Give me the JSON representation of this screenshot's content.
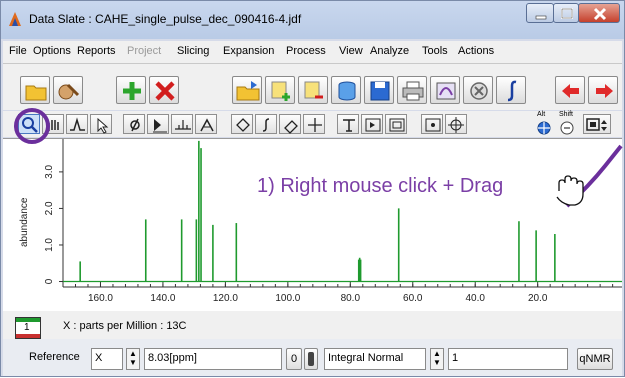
{
  "window": {
    "title": "Data Slate : CAHE_single_pulse_dec_090416-4.jdf"
  },
  "menu": [
    {
      "label": "File",
      "disabled": false
    },
    {
      "label": "Options",
      "disabled": false
    },
    {
      "label": "Reports",
      "disabled": false
    },
    {
      "label": "Project",
      "disabled": true
    },
    {
      "label": "Slicing",
      "disabled": false
    },
    {
      "label": "Expansion",
      "disabled": false
    },
    {
      "label": "Process",
      "disabled": false
    },
    {
      "label": "View",
      "disabled": false
    },
    {
      "label": "Analyze",
      "disabled": false
    },
    {
      "label": "Tools",
      "disabled": false
    },
    {
      "label": "Actions",
      "disabled": false
    }
  ],
  "toolbar2": {
    "alt_label": "Alt",
    "shift_label": "Shift"
  },
  "plot": {
    "ylabel": "abundance",
    "y_ticks": [
      "3.0",
      "2.0",
      "1.0",
      "0"
    ],
    "x_ticks": [
      "160.0",
      "140.0",
      "120.0",
      "100.0",
      "80.0",
      "60.0",
      "40.0",
      "20.0"
    ]
  },
  "chart_data": {
    "type": "line",
    "x_unit": "ppm",
    "xlim": [
      172,
      -7
    ],
    "ylim": [
      -0.15,
      3.9
    ],
    "peaks": [
      {
        "ppm": 166.5,
        "height": 0.55
      },
      {
        "ppm": 145.5,
        "height": 1.7
      },
      {
        "ppm": 134.0,
        "height": 1.7
      },
      {
        "ppm": 129.3,
        "height": 1.7
      },
      {
        "ppm": 128.5,
        "height": 3.85
      },
      {
        "ppm": 127.8,
        "height": 3.65
      },
      {
        "ppm": 124.0,
        "height": 1.55
      },
      {
        "ppm": 116.5,
        "height": 1.6
      },
      {
        "ppm": 76.7,
        "height": 0.6
      },
      {
        "ppm": 77.0,
        "height": 0.65
      },
      {
        "ppm": 77.3,
        "height": 0.6
      },
      {
        "ppm": 64.5,
        "height": 2.0
      },
      {
        "ppm": 26.0,
        "height": 1.65
      },
      {
        "ppm": 20.5,
        "height": 1.4
      },
      {
        "ppm": 14.5,
        "height": 1.3
      }
    ],
    "colors": {
      "trace": "#1f9a2e"
    }
  },
  "annotation": {
    "text": "1) Right mouse click + Drag",
    "color": "#7b3fa6"
  },
  "status": {
    "slice_number": "1",
    "axis_text": "X : parts per Million : 13C"
  },
  "bottom": {
    "reference_label": "Reference",
    "axis_value": "X",
    "ppm_value": "8.03[ppm]",
    "zero_label": "0",
    "integral_mode": "Integral Normal",
    "integral_value": "1",
    "qnmr_label": "qNMR"
  }
}
